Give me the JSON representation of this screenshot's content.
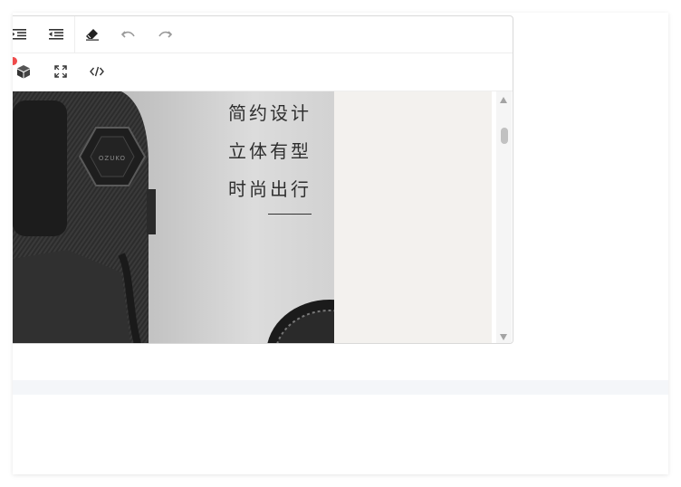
{
  "toolbar": {
    "row1": [
      {
        "name": "indent-icon"
      },
      {
        "name": "outdent-icon"
      },
      {
        "name": "eraser-icon"
      },
      {
        "name": "undo-icon"
      },
      {
        "name": "redo-icon"
      }
    ],
    "row2": [
      {
        "name": "cube-icon"
      },
      {
        "name": "fullscreen-icon"
      },
      {
        "name": "code-view-icon"
      }
    ]
  },
  "content": {
    "slogan_lines": [
      "简约设计",
      "立体有型",
      "时尚出行"
    ],
    "badge_text": "OZUKO"
  },
  "colors": {
    "border": "#d9d9d9",
    "notification_dot": "#ef4b4b",
    "beige_panel": "#f3f1ee"
  }
}
